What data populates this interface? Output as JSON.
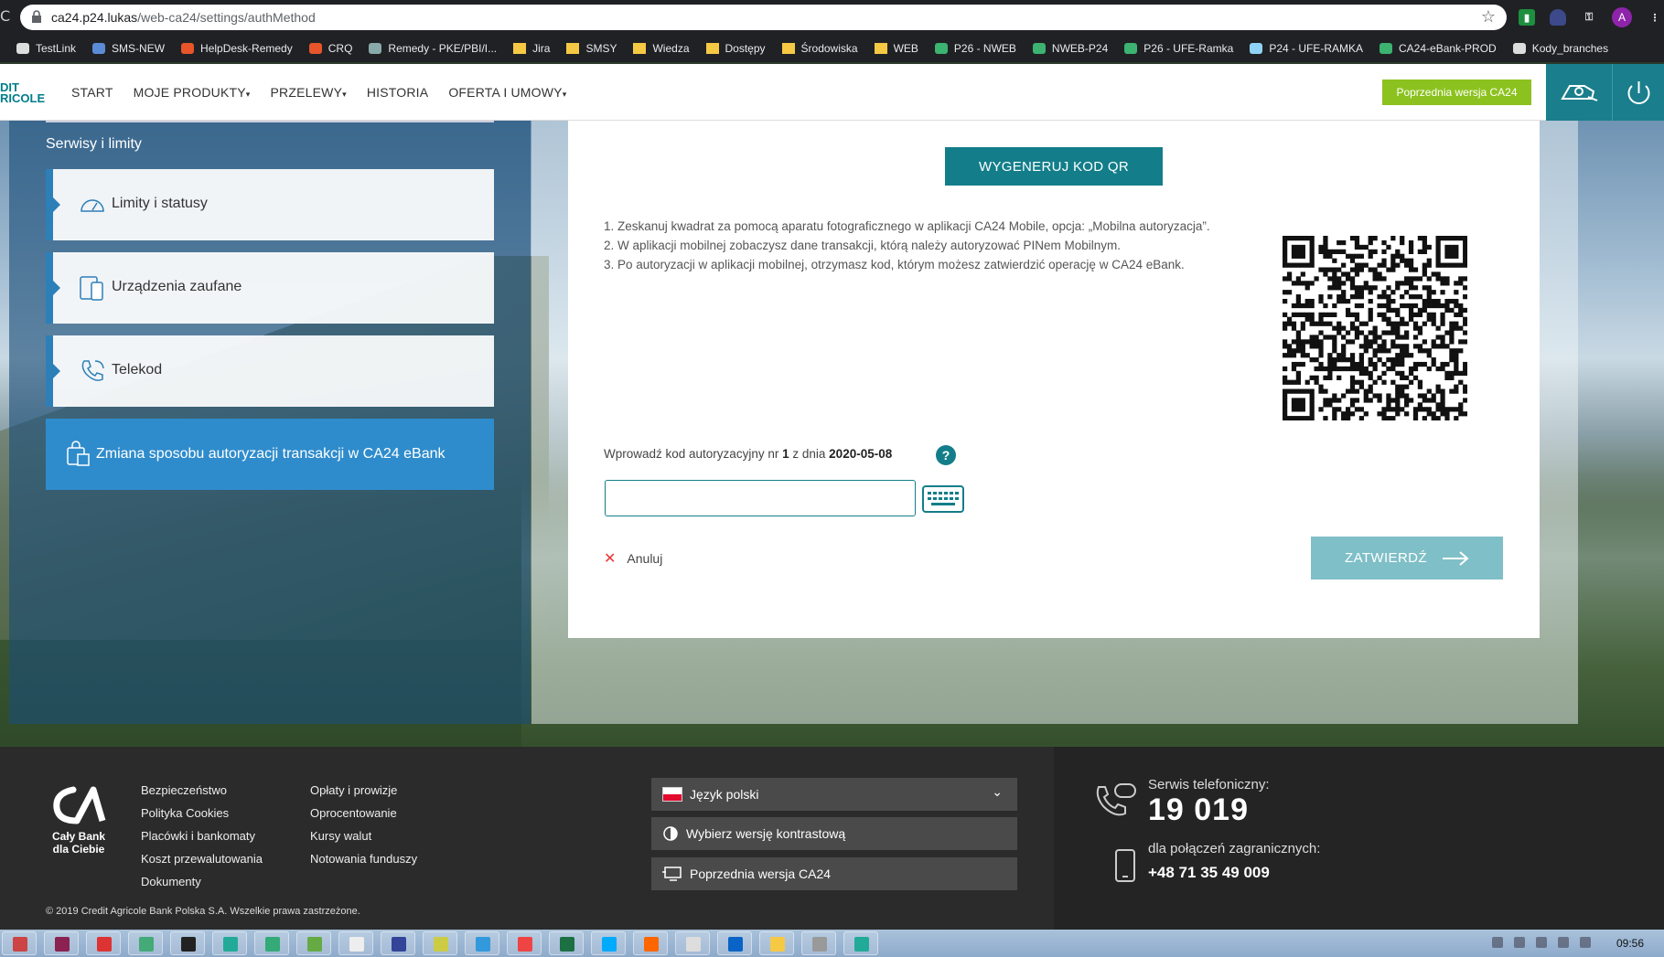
{
  "browser": {
    "url_host": "ca24.p24.lukas",
    "url_path": "/web-ca24/settings/authMethod",
    "avatar_letter": "A",
    "bookmarks": [
      {
        "label": "TestLink",
        "icon": "testlink-icon",
        "color": "#ddd"
      },
      {
        "label": "SMS-NEW",
        "icon": "diamond-icon",
        "color": "#5c8bd6"
      },
      {
        "label": "HelpDesk-Remedy",
        "icon": "remedy-icon",
        "color": "#e8552b"
      },
      {
        "label": "CRQ",
        "icon": "remedy-icon",
        "color": "#e8552b"
      },
      {
        "label": "Remedy - PKE/PBI/I...",
        "icon": "play-icon",
        "color": "#8aa"
      },
      {
        "label": "Jira",
        "icon": "folder-icon",
        "color": "#f6c945"
      },
      {
        "label": "SMSY",
        "icon": "folder-icon",
        "color": "#f6c945"
      },
      {
        "label": "Wiedza",
        "icon": "folder-icon",
        "color": "#f6c945"
      },
      {
        "label": "Dostępy",
        "icon": "folder-icon",
        "color": "#f6c945"
      },
      {
        "label": "Środowiska",
        "icon": "folder-icon",
        "color": "#f6c945"
      },
      {
        "label": "WEB",
        "icon": "folder-icon",
        "color": "#f6c945"
      },
      {
        "label": "P26 - NWEB",
        "icon": "ca-icon",
        "color": "#3cb371"
      },
      {
        "label": "NWEB-P24",
        "icon": "ca-icon",
        "color": "#3cb371"
      },
      {
        "label": "P26 - UFE-Ramka",
        "icon": "ca-icon",
        "color": "#3cb371"
      },
      {
        "label": "P24 - UFE-RAMKA",
        "icon": "ca-icon",
        "color": "#8fd3f4"
      },
      {
        "label": "CA24-eBank-PROD",
        "icon": "ca-icon",
        "color": "#3cb371"
      },
      {
        "label": "Kody_branches",
        "icon": "github-icon",
        "color": "#ddd"
      }
    ]
  },
  "header": {
    "logo_line1": "DIT",
    "logo_line2": "RICOLE",
    "nav": [
      "START",
      "MOJE PRODUKTY",
      "PRZELEWY",
      "HISTORIA",
      "OFERTA I UMOWY"
    ],
    "prev_version_button": "Poprzednia wersja CA24"
  },
  "sidebar": {
    "title": "Serwisy i limity",
    "items": [
      {
        "label": "Limity i statusy",
        "icon": "gauge-icon"
      },
      {
        "label": "Urządzenia zaufane",
        "icon": "devices-icon"
      },
      {
        "label": "Telekod",
        "icon": "phone-icon"
      }
    ],
    "active": {
      "label": "Zmiana sposobu autoryzacji transakcji w CA24 eBank",
      "icon": "auth-icon"
    }
  },
  "main": {
    "generate_button": "WYGENERUJ KOD QR",
    "steps": [
      "1. Zeskanuj kwadrat za pomocą aparatu fotograficznego w aplikacji CA24 Mobile, opcja: „Mobilna autoryzacja”.",
      "2. W aplikacji mobilnej zobaczysz dane transakcji, którą należy autoryzować PINem Mobilnym.",
      "3. Po autoryzacji w aplikacji mobilnej, otrzymasz kod, którym możesz zatwierdzić operację w CA24 eBank."
    ],
    "code_label_prefix": "Wprowadź kod autoryzacyjny nr",
    "code_number": "1",
    "code_label_mid": "z dnia",
    "code_date": "2020-05-08",
    "help_glyph": "?",
    "code_value": "",
    "cancel_label": "Anuluj",
    "confirm_label": "ZATWIERDŹ"
  },
  "footer": {
    "logo_text": "Cały Bank dla Ciebie",
    "col1": [
      "Bezpieczeństwo",
      "Polityka Cookies",
      "Placówki i bankomaty",
      "Koszt przewalutowania",
      "Dokumenty"
    ],
    "col2": [
      "Opłaty i prowizje",
      "Oprocentowanie",
      "Kursy walut",
      "Notowania funduszy"
    ],
    "language": "Język polski",
    "contrast": "Wybierz wersję kontrastową",
    "prev_version": "Poprzednia wersja CA24",
    "copyright": "© 2019 Credit Agricole Bank Polska S.A. Wszelkie prawa zastrzeżone.",
    "phone_label": "Serwis telefoniczny:",
    "phone_number": "19 019",
    "abroad_label": "dla połączeń zagranicznych:",
    "abroad_number": "+48 71 35 49 009"
  },
  "taskbar": {
    "clock": "09:56",
    "apps": [
      {
        "icon": "start-icon",
        "color": "#c44"
      },
      {
        "icon": "archive-icon",
        "color": "#8b2252"
      },
      {
        "icon": "sync-icon",
        "color": "#d33"
      },
      {
        "icon": "network-icon",
        "color": "#4a7"
      },
      {
        "icon": "terminal-icon",
        "color": "#222"
      },
      {
        "icon": "ca-icon",
        "color": "#2a9"
      },
      {
        "icon": "chart-icon",
        "color": "#3a7"
      },
      {
        "icon": "putty-icon",
        "color": "#6a4"
      },
      {
        "icon": "soccer-icon",
        "color": "#eee"
      },
      {
        "icon": "save-icon",
        "color": "#349"
      },
      {
        "icon": "notepad-icon",
        "color": "#cc4"
      },
      {
        "icon": "ie-icon",
        "color": "#39d"
      },
      {
        "icon": "chrome-icon",
        "color": "#e44"
      },
      {
        "icon": "excel-icon",
        "color": "#1d7044"
      },
      {
        "icon": "skype-icon",
        "color": "#0af"
      },
      {
        "icon": "firefox-icon",
        "color": "#f60"
      },
      {
        "icon": "explorer-icon",
        "color": "#ddd"
      },
      {
        "icon": "outlook-icon",
        "color": "#0a64c8"
      },
      {
        "icon": "folder-icon",
        "color": "#f6c945"
      },
      {
        "icon": "tool-icon",
        "color": "#999"
      },
      {
        "icon": "ca-icon",
        "color": "#2a9"
      }
    ]
  }
}
